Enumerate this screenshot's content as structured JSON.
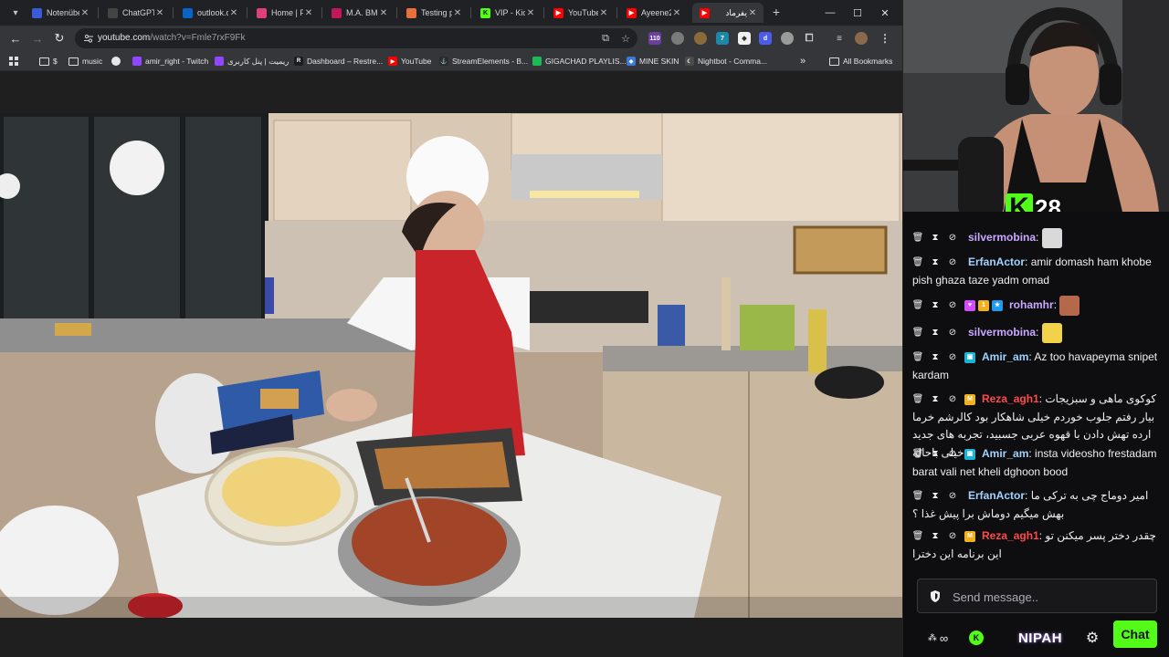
{
  "browser": {
    "tabs": [
      {
        "title": "Notenübe",
        "icon": "notes-icon",
        "color": "#3b5bdb"
      },
      {
        "title": "ChatGPT",
        "icon": "chatgpt-icon",
        "color": "#444444"
      },
      {
        "title": "outlook.c",
        "icon": "outlook-icon",
        "color": "#0a64c8"
      },
      {
        "title": "Home | F",
        "icon": "home-icon",
        "color": "#e0407a"
      },
      {
        "title": "M.A. BMe",
        "icon": "pdf-icon",
        "color": "#c2185b"
      },
      {
        "title": "Testing p",
        "icon": "asterisk-icon",
        "color": "#e8703a"
      },
      {
        "title": "VIP - Kick",
        "icon": "kick-icon",
        "color": "#53fc18"
      },
      {
        "title": "YouTube",
        "icon": "youtube-icon",
        "color": "#ff0000"
      },
      {
        "title": "Ayeene2",
        "icon": "youtube-icon",
        "color": "#ff0000"
      },
      {
        "title": "یفرماد",
        "icon": "youtube-icon",
        "color": "#ff0000",
        "active": true
      }
    ],
    "url_host": "youtube.com",
    "url_path": "/watch?v=Fmle7rxF9Fk",
    "extension_badge": "110",
    "bookmarks": [
      {
        "label": "$",
        "icon": "folder-icon"
      },
      {
        "label": "music",
        "icon": "folder-icon"
      },
      {
        "label": "",
        "icon": "globe-icon"
      },
      {
        "label": "amir_right - Twitch",
        "icon": "twitch-icon"
      },
      {
        "label": "ریمیت | پنل کاربری",
        "icon": "twitch-icon"
      },
      {
        "label": "Dashboard – Restre...",
        "icon": "restream-icon"
      },
      {
        "label": "YouTube",
        "icon": "youtube-icon"
      },
      {
        "label": "StreamElements - B...",
        "icon": "streamelements-icon"
      },
      {
        "label": "GIGACHAD PLAYLIS...",
        "icon": "spotify-icon"
      },
      {
        "label": "MINE SKIN",
        "icon": "mineskin-icon"
      },
      {
        "label": "Nightbot - Comma...",
        "icon": "nightbot-icon"
      }
    ],
    "all_bookmarks": "All Bookmarks",
    "more_bookmarks": "»"
  },
  "stream": {
    "viewer_count": "28",
    "kick_logo": "K",
    "chat": [
      {
        "user": "silvermobina",
        "user_color": "#c9a8ff",
        "text": "",
        "badges": [],
        "emote": "hand-emote"
      },
      {
        "user": "ErfanActor",
        "user_color": "#9fd3ff",
        "text": "amir domash ham khobe pish ghaza taze yadm omad",
        "badges": []
      },
      {
        "user": "rohamhr",
        "user_color": "#c9a8ff",
        "text": "",
        "badges": [
          "heart-badge",
          "gift-badge",
          "vip-badge"
        ],
        "emote": "face-emote"
      },
      {
        "user": "silvermobina",
        "user_color": "#c9a8ff",
        "text": "",
        "badges": [],
        "emote": "peek-emote"
      },
      {
        "user": "Amir_am",
        "user_color": "#9fd3ff",
        "text": "Az too havapeyma snipet kardam",
        "badges": [
          "sub-badge"
        ]
      },
      {
        "user": "Reza_agh1",
        "user_color": "#ff4a4a",
        "text": "کوکوی ماهی و سبزیجات بیار رفتم جلوب خوردم خیلی شاهکار بود کالرشم خرما ارده تهش دادن با قهوه عربی جسبید، تجربه های جدید خیلی باحاله",
        "badges": [
          "mod-badge"
        ],
        "rtl": true
      },
      {
        "user": "Amir_am",
        "user_color": "#9fd3ff",
        "text": "insta videosho frestadam barat vali net kheli dghoon bood",
        "badges": [
          "sub-badge"
        ]
      },
      {
        "user": "ErfanActor",
        "user_color": "#9fd3ff",
        "text": "امیر دوماج چی به ترکی ما بهش میگیم دوماش برا پیش غذا ؟",
        "badges": [],
        "rtl": true
      },
      {
        "user": "Reza_agh1",
        "user_color": "#ff4a4a",
        "text": "چقدر دختر پسر میکنن تو این برنامه این دخترا",
        "badges": [
          "mod-badge"
        ],
        "rtl": true
      }
    ],
    "input_placeholder": "Send message..",
    "footer": {
      "nipah": "NIPAH",
      "chat_button": "Chat",
      "infinity": "∞"
    }
  }
}
